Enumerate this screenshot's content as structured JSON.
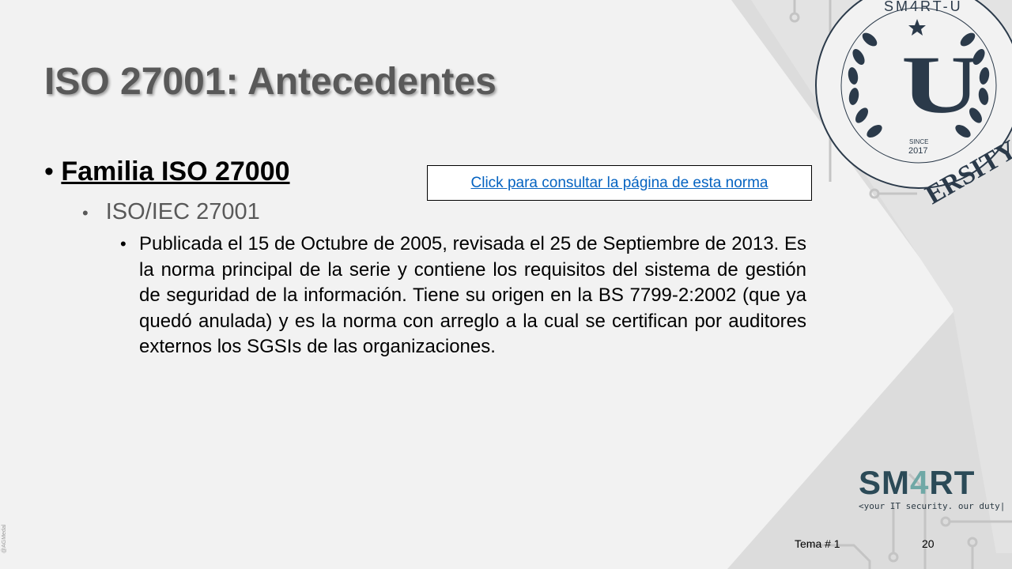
{
  "title": "ISO 27001: Antecedentes",
  "content": {
    "level1": {
      "bullet": "•",
      "text": "Familia ISO 27000"
    },
    "level2": {
      "bullet": "•",
      "text": "ISO/IEC 27001"
    },
    "level3": {
      "bullet": "•",
      "text": "Publicada el 15 de Octubre de 2005, revisada el 25 de Septiembre de 2013. Es la norma principal de la serie y contiene los requisitos del sistema de gestión de seguridad de la información. Tiene su origen en la BS 7799-2:2002 (que ya quedó anulada) y es la norma con arreglo a la cual se certifican por auditores externos los SGSIs de las organizaciones."
    }
  },
  "link": {
    "label": "Click para consultar la página de esta norma"
  },
  "badge": {
    "top_text": "SM4RT-U",
    "bottom_text": "ERSITY",
    "since": "SINCE",
    "year": "2017",
    "letter": "U"
  },
  "brand": {
    "word_part1": "SM",
    "word_accent": "4",
    "word_part2": "RT",
    "tagline": "<your IT security. our duty|"
  },
  "footer": {
    "tema": "Tema # 1",
    "page": "20"
  },
  "watermark": "@AGMedal",
  "colors": {
    "title": "#595959",
    "link": "#0563c1",
    "brand_dark": "#2b4a57",
    "brand_accent": "#6fa8a6",
    "background": "#f2f2f2"
  }
}
